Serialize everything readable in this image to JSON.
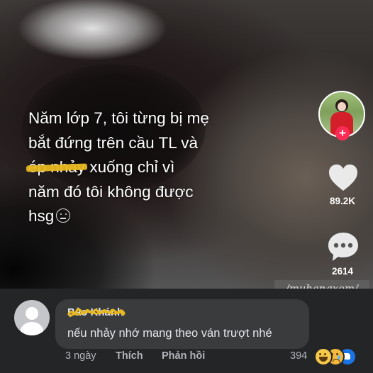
{
  "video": {
    "caption_lines": [
      [
        "Năm lớp 7, tôi từng bị mẹ"
      ],
      [
        "bắt đứng trên cầu TL và"
      ],
      [
        "ép nhảy",
        " xuống chỉ vì"
      ],
      [
        "năm đó tôi không được"
      ],
      [
        "hsg"
      ]
    ],
    "caption": {
      "line1": "Năm lớp 7, tôi từng bị mẹ",
      "line2": "bắt đứng trên cầu TL và",
      "line3_struck": "ép nhảy",
      "line3_rest": " xuống chỉ vì",
      "line4": "năm đó tôi không được",
      "line5": "hsg"
    },
    "caption_emoji": "neutral-face-icon",
    "like_count": "89.2K",
    "comment_count": "2614",
    "follow_symbol": "+",
    "watermark": "/muhangxom/"
  },
  "comment": {
    "author_name": "Bảo Khánh",
    "author_name_obscured": true,
    "text": "nếu nhảy nhớ mang theo ván trượt nhé",
    "time": "3 ngày",
    "like_label": "Thích",
    "reply_label": "Phản hồi",
    "reaction_count": "394",
    "reactions": [
      "haha",
      "sad",
      "like"
    ]
  },
  "colors": {
    "strike_highlight": "#e8b820",
    "follow_button": "#fe2c55",
    "like_reaction": "#1b74e4",
    "bubble": "#3a3b3c",
    "panel": "#242527"
  }
}
